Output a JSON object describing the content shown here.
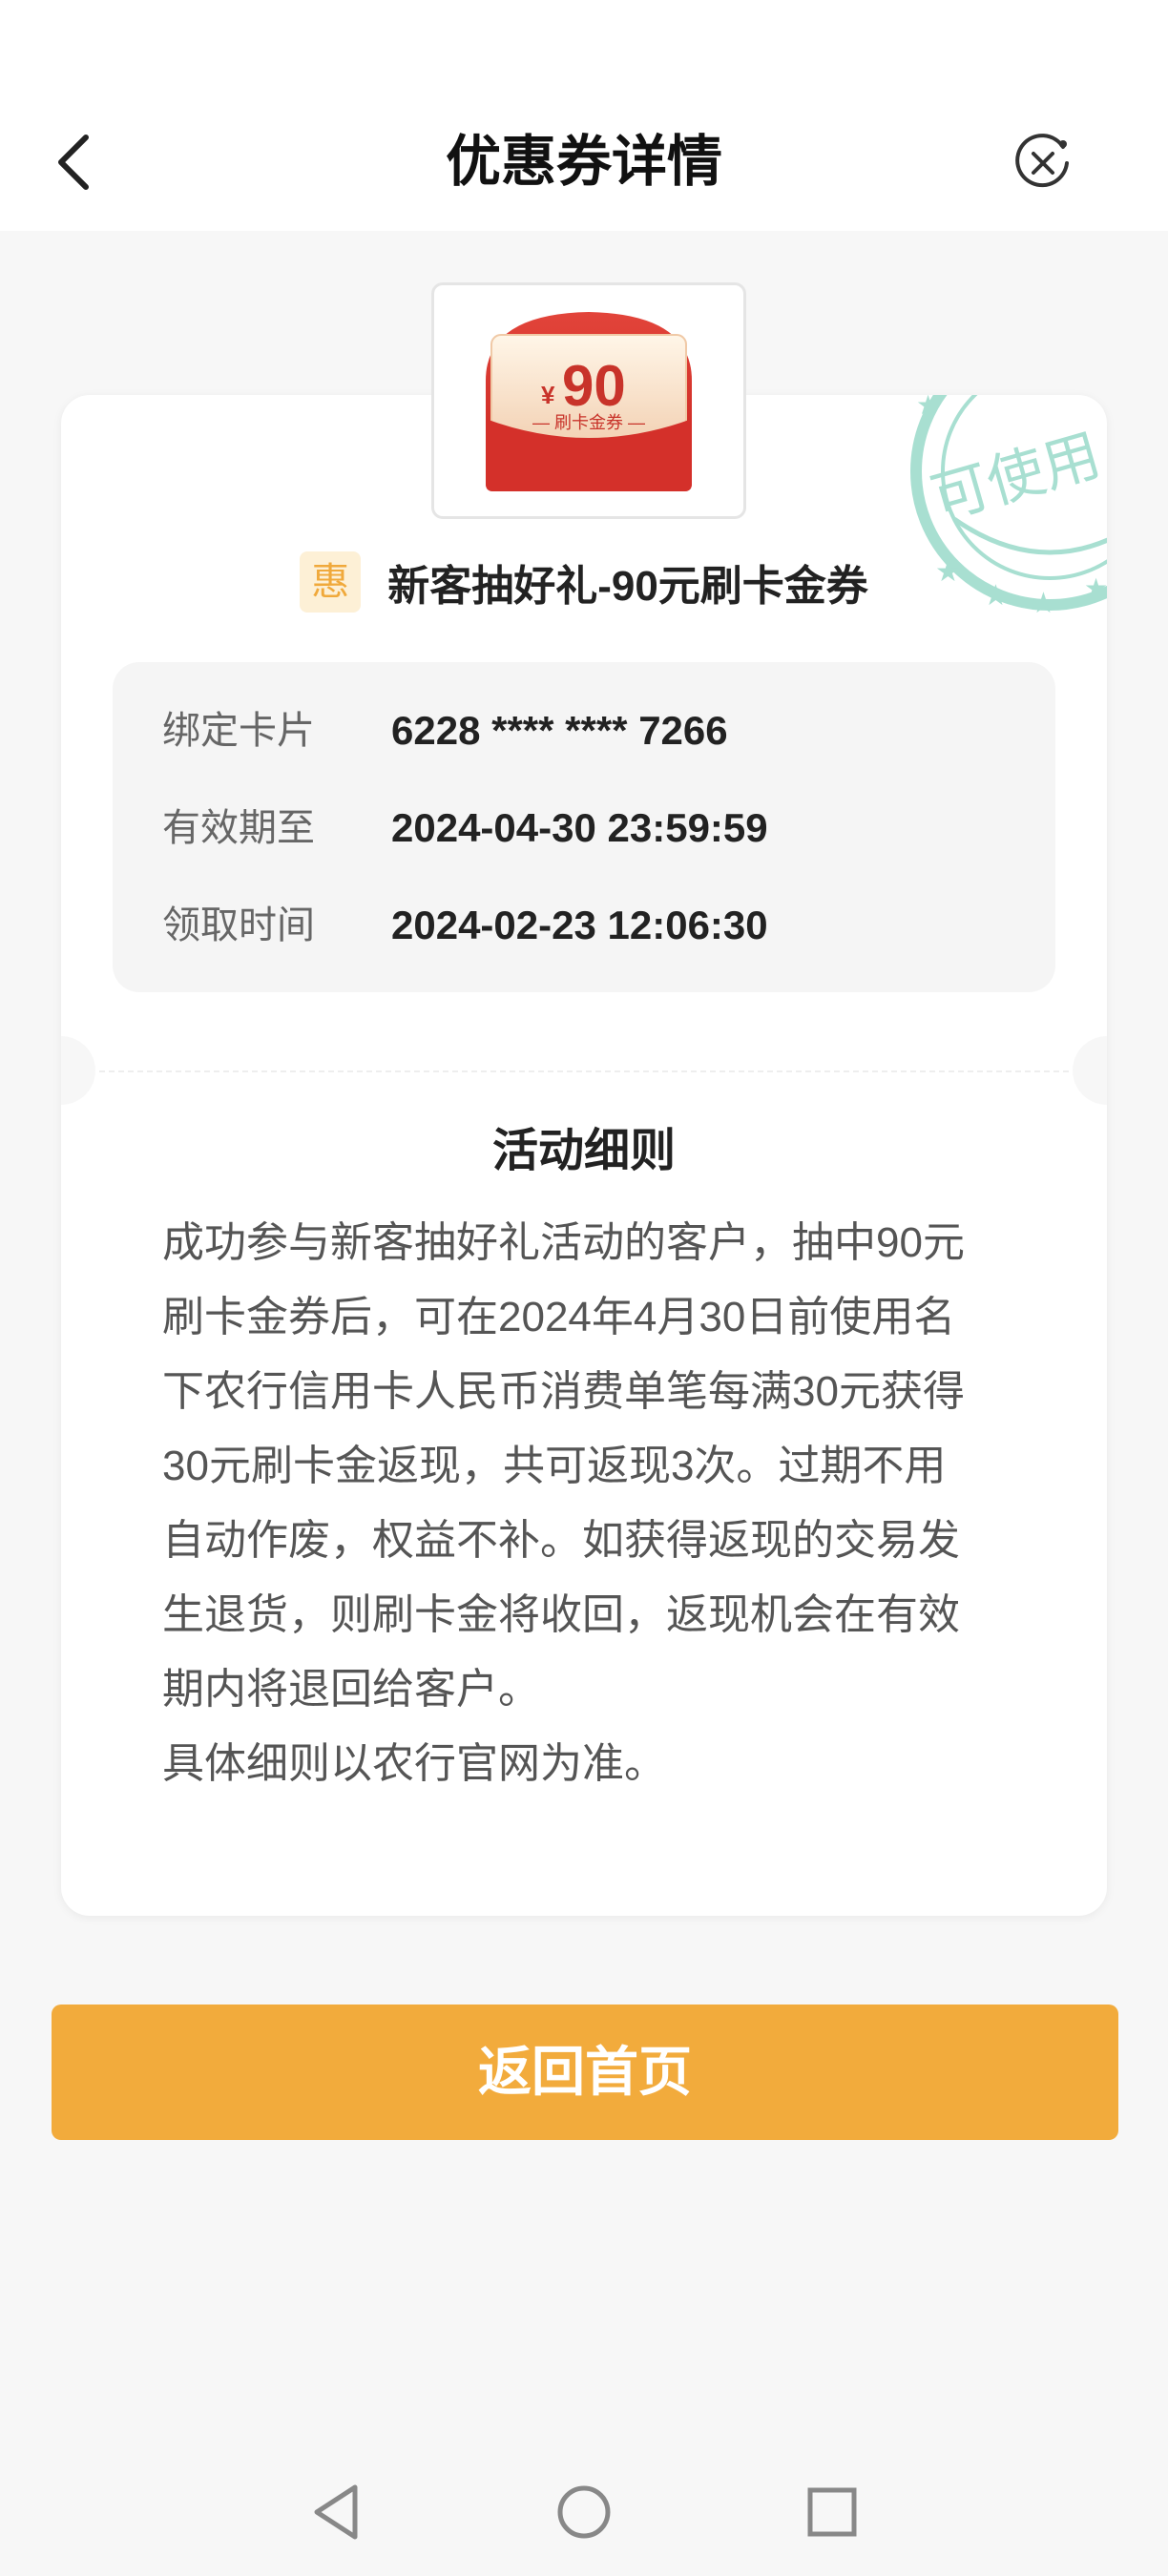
{
  "header": {
    "title": "优惠券详情",
    "back_icon": "chevron-left-icon",
    "close_icon": "close-circle-icon"
  },
  "coupon_image": {
    "currency_symbol": "¥",
    "amount": "90",
    "label": "— 刷卡金券 —"
  },
  "stamp": {
    "text": "可使用",
    "color": "#9fdccd"
  },
  "coupon": {
    "badge": "惠",
    "name": "新客抽好礼-90元刷卡金券"
  },
  "details": [
    {
      "label": "绑定卡片",
      "value": "6228 **** **** 7266"
    },
    {
      "label": "有效期至",
      "value": "2024-04-30 23:59:59"
    },
    {
      "label": "领取时间",
      "value": "2024-02-23 12:06:30"
    }
  ],
  "rules": {
    "title": "活动细则",
    "text": "成功参与新客抽好礼活动的客户，抽中90元\n刷卡金券后，可在2024年4月30日前使用名\n下农行信用卡人民币消费单笔每满30元获得\n30元刷卡金返现，共可返现3次。过期不用\n自动作废，权益不补。如获得返现的交易发\n生退货，则刷卡金将收回，返现机会在有效\n期内将退回给客户。\n具体细则以农行官网为准。"
  },
  "actions": {
    "home_label": "返回首页"
  },
  "colors": {
    "accent": "#f2ab3c",
    "page_bg": "#f7f7f7",
    "coupon_red": "#d8322a"
  },
  "system_nav": {
    "back_icon": "nav-back-triangle-icon",
    "home_icon": "nav-home-circle-icon",
    "recents_icon": "nav-recents-square-icon"
  }
}
